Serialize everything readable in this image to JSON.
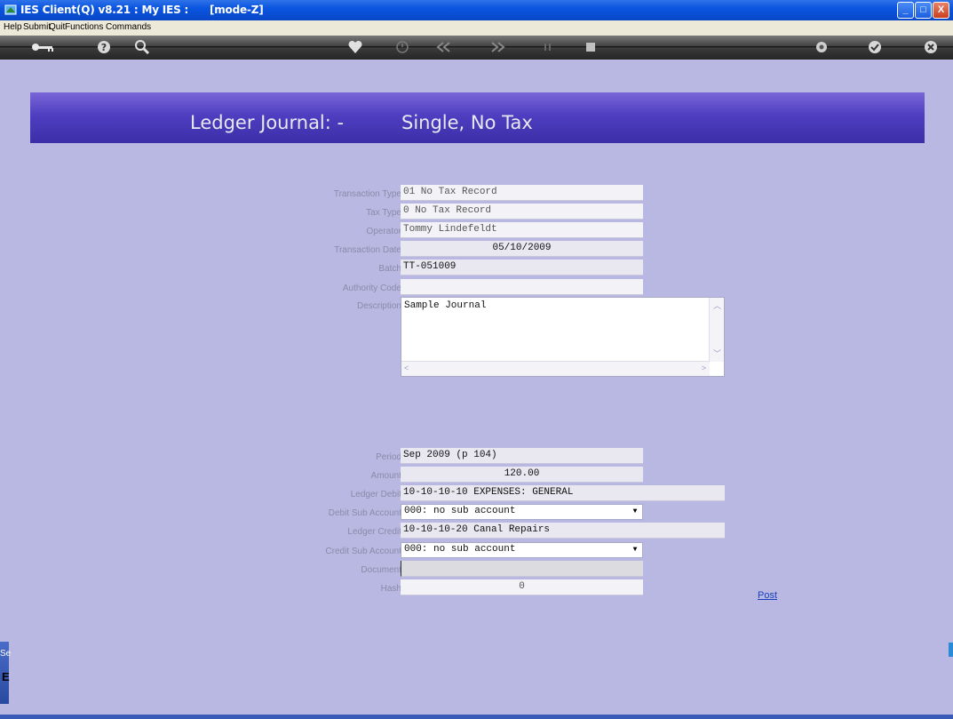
{
  "window": {
    "title": "IES Client(Q) v8.21 : My IES :      [mode-Z]",
    "buttons": {
      "minimize": "_",
      "maximize": "□",
      "close": "X"
    }
  },
  "menu": [
    "Help",
    "Submit",
    "Quit",
    "Functions",
    "Commands"
  ],
  "toolbar": {
    "icons": [
      "key-icon",
      "help-icon",
      "search-icon",
      "heart-icon",
      "clock-icon",
      "rewind-icon",
      "fast-forward-icon",
      "pause-icon",
      "stop-icon",
      "settings-icon",
      "check-icon",
      "close-icon"
    ]
  },
  "header": {
    "title": "Ledger Journal: -",
    "subtitle": "Single, No Tax"
  },
  "form": {
    "transaction_type": {
      "label": "Transaction Type",
      "value": "01 No Tax Record"
    },
    "tax_type": {
      "label": "Tax Type",
      "value": "0 No Tax Record"
    },
    "operator": {
      "label": "Operator",
      "value": "Tommy Lindefeldt"
    },
    "transaction_date": {
      "label": "Transaction Date",
      "value": "05/10/2009"
    },
    "batch": {
      "label": "Batch",
      "value": "TT-051009"
    },
    "authority_code": {
      "label": "Authority Code",
      "value": ""
    },
    "description": {
      "label": "Description",
      "value": "Sample Journal"
    },
    "period": {
      "label": "Period",
      "value": "Sep 2009 (p 104)"
    },
    "amount": {
      "label": "Amount",
      "value": "120.00"
    },
    "ledger_debit": {
      "label": "Ledger Debit",
      "value": "10-10-10-10 EXPENSES: GENERAL"
    },
    "debit_sub_account": {
      "label": "Debit Sub Account",
      "value": "000: no sub account"
    },
    "ledger_credit": {
      "label": "Ledger Credit",
      "value": "10-10-10-20 Canal Repairs"
    },
    "credit_sub_account": {
      "label": "Credit Sub Account",
      "value": "000: no sub account"
    },
    "document": {
      "label": "Document",
      "value": ""
    },
    "hash": {
      "label": "Hash",
      "value": "0"
    }
  },
  "actions": {
    "post": "Post"
  },
  "side_panel": {
    "label": "Se",
    "glyph": "E"
  },
  "colors": {
    "client_bg": "#b8b8e2",
    "header_band": "#4f3ec0",
    "title_bar": "#0a55e0",
    "link": "#1a3fb8"
  }
}
